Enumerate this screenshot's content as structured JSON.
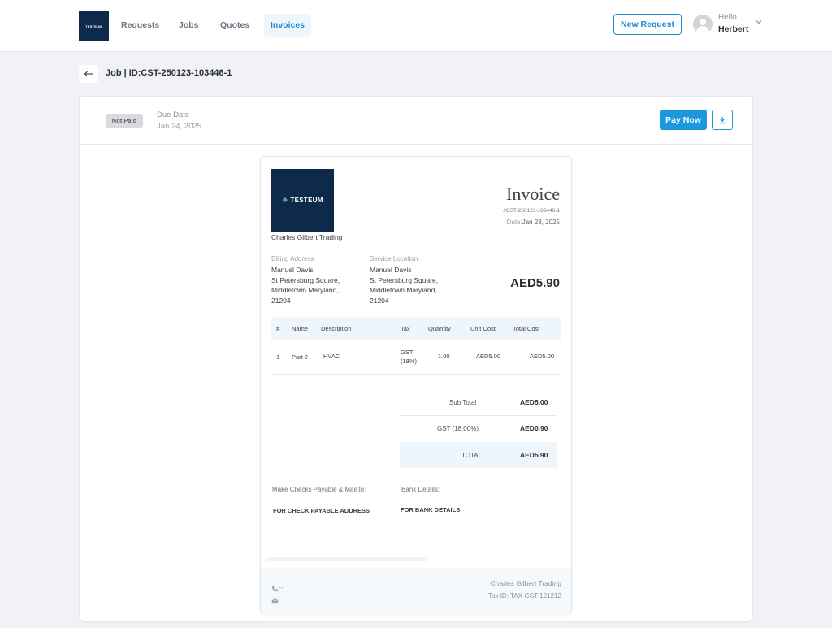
{
  "nav": {
    "logo_text": "TESTEUM",
    "items": [
      {
        "label": "Requests"
      },
      {
        "label": "Jobs"
      },
      {
        "label": "Quotes"
      },
      {
        "label": "Invoices"
      }
    ],
    "new_request_label": "New Request",
    "greeting": "Hello",
    "user_name": "Herbert"
  },
  "page": {
    "title": "Job | ID:CST-250123-103446-1"
  },
  "status_bar": {
    "status_badge": "Not Paid",
    "due_label": "Due Date",
    "due_date": "Jan 24, 2025",
    "pay_now_label": "Pay Now"
  },
  "invoice": {
    "logo_text": "TESTEUM",
    "company_name": "Charles Gilbert Trading",
    "heading": "Invoice",
    "number": "#CST-250123-103446-1",
    "date_label": "Date:",
    "date": "Jan 23, 2025",
    "billing": {
      "label": "Billing Address",
      "lines": [
        "Manuel Davis",
        "St Petersburg Square,",
        "Middletown Maryland,",
        "21204"
      ]
    },
    "service": {
      "label": "Service Location",
      "lines": [
        "Manuel Davis",
        "St Petersburg Square,",
        "Middletown Maryland,",
        "21204"
      ]
    },
    "total_amount": "AED5.90",
    "table": {
      "headers": [
        "#",
        "Name",
        "Description",
        "Tax",
        "Quantity",
        "Unit Cost",
        "Total Cost"
      ],
      "rows": [
        {
          "num": "1",
          "name": "Part 2",
          "description": "HVAC",
          "tax_line1": "GST",
          "tax_line2": "(18%)",
          "quantity": "1.00",
          "unit_cost": "AED5.00",
          "total_cost": "AED5.00"
        }
      ]
    },
    "summary": {
      "subtotal_label": "Sub Total",
      "subtotal_value": "AED5.00",
      "gst_label": "GST (18.00%)",
      "gst_value": "AED0.90",
      "total_label": "TOTAL",
      "total_value": "AED5.90"
    },
    "payment": {
      "checks_label": "Make Checks Payable & Mail to:",
      "checks_value": "FOR CHECK PAYABLE  ADDRESS",
      "bank_label": "Bank Details:",
      "bank_value": "FOR BANK DETAILS"
    },
    "footer": {
      "phone": "--",
      "company": "Charles Gilbert Trading",
      "tax_id": "Tax ID: TAX-GST-121212"
    }
  },
  "colors": {
    "accent": "#1b98e0",
    "nav_active": "#1b8ad1",
    "logo_bg": "#0d2a4b",
    "table_head_bg": "#eef5fb"
  },
  "icons": [
    "arrow-left-icon",
    "chevron-down-icon",
    "download-icon",
    "phone-icon",
    "mail-icon",
    "user-avatar-icon"
  ]
}
